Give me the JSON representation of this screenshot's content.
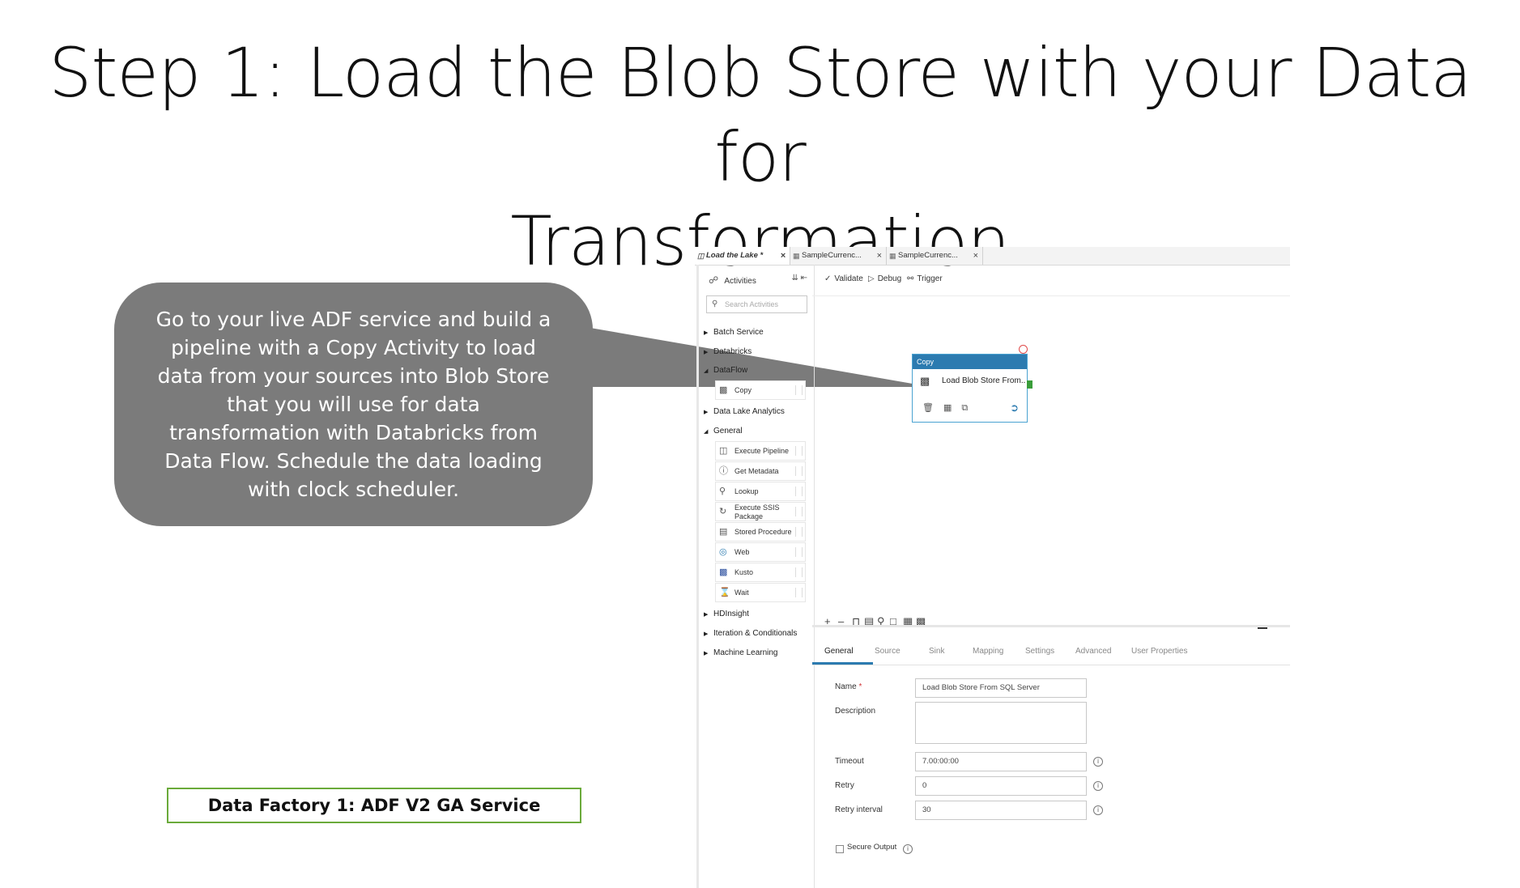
{
  "slide": {
    "title_line1": "Step 1: Load the Blob Store with your Data for",
    "title_line2": "Transformation",
    "callout_text": "Go to your live ADF service and build a pipeline with a Copy Activity to load data from your sources into Blob Store that you will use for data transformation with Databricks from Data Flow. Schedule the data loading with clock scheduler.",
    "service_label": "Data Factory 1: ADF V2 GA Service"
  },
  "tabs": [
    {
      "label": "Load the Lake *",
      "icon": "pipeline-icon"
    },
    {
      "label": "SampleCurrenc...",
      "icon": "table-icon"
    },
    {
      "label": "SampleCurrenc...",
      "icon": "table-icon"
    }
  ],
  "activities": {
    "header": "Activities",
    "search_placeholder": "Search Activities",
    "categories": {
      "batch_service": "Batch Service",
      "databricks": "Databricks",
      "dataflow": "DataFlow",
      "data_lake_analytics": "Data Lake Analytics",
      "general": "General",
      "hdinsight": "HDInsight",
      "iteration": "Iteration & Conditionals",
      "machine_learning": "Machine Learning"
    },
    "dataflow_items": [
      "Copy"
    ],
    "general_items": [
      "Execute Pipeline",
      "Get Metadata",
      "Lookup",
      "Execute SSIS",
      "Package",
      "Stored Procedure",
      "Web",
      "Kusto",
      "Wait"
    ]
  },
  "toolbar": {
    "validate": "Validate",
    "debug": "Debug",
    "trigger": "Trigger"
  },
  "node": {
    "type": "Copy",
    "name": "Load Blob Store From..."
  },
  "properties": {
    "tabs": [
      "General",
      "Source",
      "Sink",
      "Mapping",
      "Settings",
      "Advanced",
      "User Properties"
    ],
    "active_tab": "General",
    "name_label": "Name",
    "required_mark": "*",
    "name_value": "Load Blob Store From SQL Server",
    "description_label": "Description",
    "timeout_label": "Timeout",
    "timeout_value": "7.00:00:00",
    "retry_label": "Retry",
    "retry_value": "0",
    "retry_interval_label": "Retry interval",
    "retry_interval_value": "30",
    "secure_output_label": "Secure Output"
  },
  "colors": {
    "callout": "#7b7b7b",
    "service_border": "#6aaa3a",
    "node_header": "#2c7bb0",
    "port": "#3a9d3a"
  }
}
